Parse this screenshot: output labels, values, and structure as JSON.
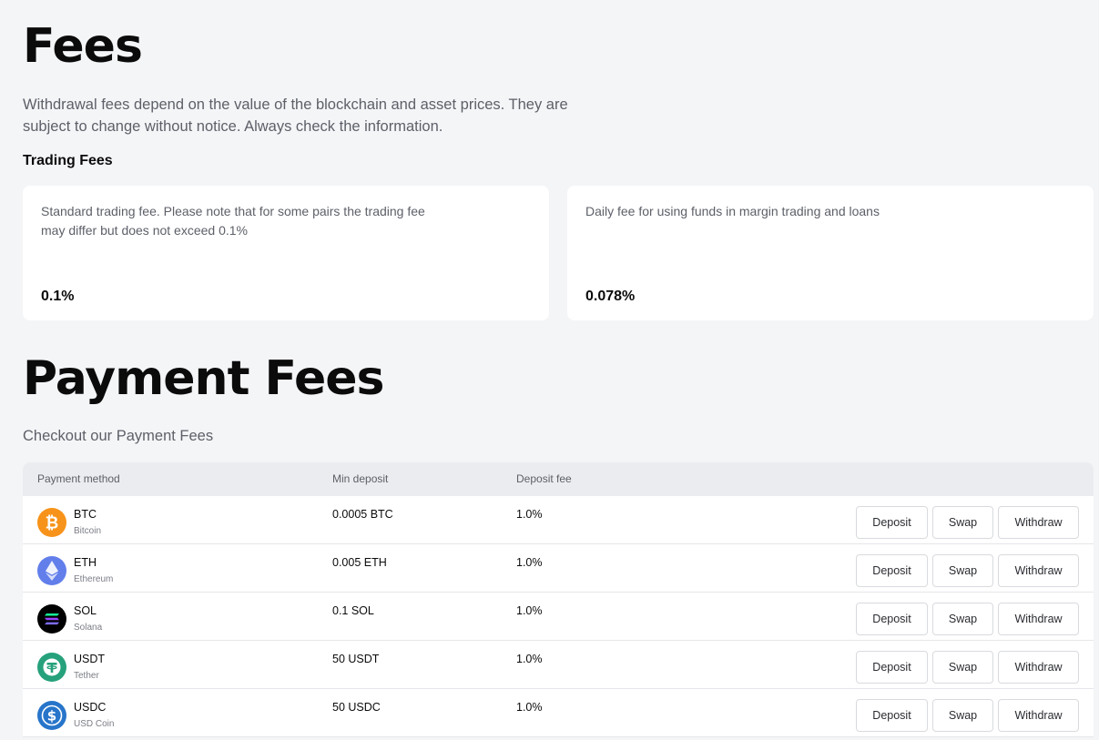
{
  "fees": {
    "title": "Fees",
    "intro": "Withdrawal fees depend on the value of the blockchain and asset prices. They are subject to change without notice. Always check the information.",
    "trading_heading": "Trading Fees",
    "cards": [
      {
        "description": "Standard trading fee. Please note that for some pairs the trading fee may differ but does not exceed 0.1%",
        "value": "0.1%"
      },
      {
        "description": "Daily fee for using funds in margin trading and loans",
        "value": "0.078%"
      }
    ]
  },
  "payment": {
    "title": "Payment Fees",
    "subtitle": "Checkout our Payment Fees",
    "columns": {
      "method": "Payment method",
      "min": "Min deposit",
      "fee": "Deposit fee"
    },
    "buttons": {
      "deposit": "Deposit",
      "swap": "Swap",
      "withdraw": "Withdraw"
    },
    "rows": [
      {
        "symbol": "BTC",
        "name": "Bitcoin",
        "min": "0.0005 BTC",
        "fee": "1.0%",
        "icon": "bitcoin-icon",
        "color": "#f7931a"
      },
      {
        "symbol": "ETH",
        "name": "Ethereum",
        "min": "0.005 ETH",
        "fee": "1.0%",
        "icon": "ethereum-icon",
        "color": "#627eea"
      },
      {
        "symbol": "SOL",
        "name": "Solana",
        "min": "0.1 SOL",
        "fee": "1.0%",
        "icon": "solana-icon",
        "color": "#000000"
      },
      {
        "symbol": "USDT",
        "name": "Tether",
        "min": "50 USDT",
        "fee": "1.0%",
        "icon": "tether-icon",
        "color": "#26a17b"
      },
      {
        "symbol": "USDC",
        "name": "USD Coin",
        "min": "50 USDC",
        "fee": "1.0%",
        "icon": "usd-coin-icon",
        "color": "#2775ca"
      }
    ]
  }
}
